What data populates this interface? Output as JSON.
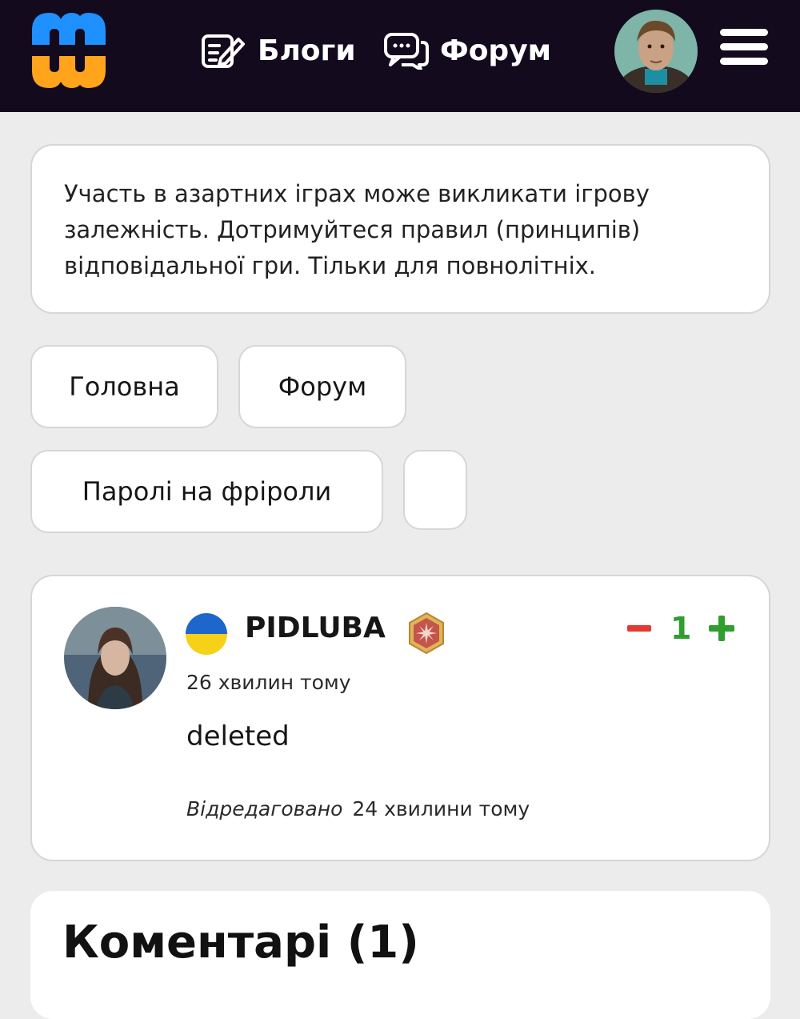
{
  "header": {
    "nav": [
      {
        "label": "Блоги",
        "icon": "edit-document-icon"
      },
      {
        "label": "Форум",
        "icon": "chat-bubbles-icon"
      }
    ],
    "logo_colors": {
      "top": "#1e90ff",
      "bottom": "#ffa41b"
    },
    "background": "#140a1e"
  },
  "notice": {
    "text": "Участь в азартних іграх може викликати ігрову залежність. Дотримуйтеся правил (принципів) відповідальної гри. Тільки для повнолітніх."
  },
  "breadcrumbs": [
    {
      "label": "Головна"
    },
    {
      "label": "Форум"
    },
    {
      "label": "Паролі на фріроли"
    },
    {
      "label": ""
    }
  ],
  "post": {
    "username": "PIDLUBA",
    "country_flag": "ukraine-flag-icon",
    "rating": "1",
    "time": "26 хвилин тому",
    "body": "deleted",
    "edited_label": "Відредаговано",
    "edited_time": "24 хвилини тому"
  },
  "comments": {
    "title": "Коментарі (1)"
  },
  "colors": {
    "vote_minus": "#e53a31",
    "vote_plus": "#2f9e2f"
  }
}
